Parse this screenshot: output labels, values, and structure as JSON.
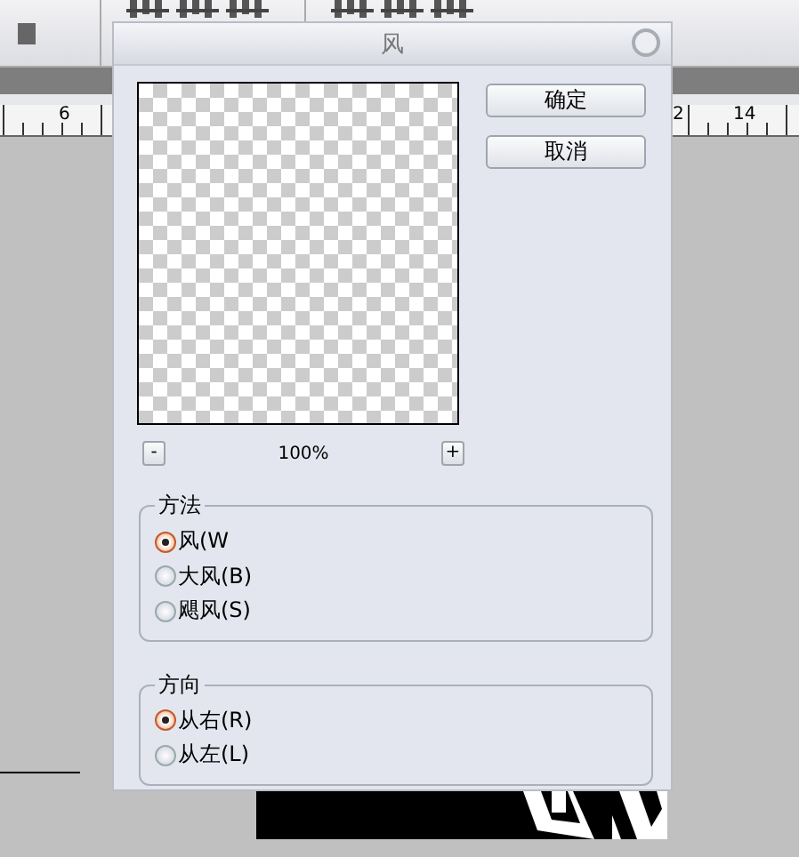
{
  "ruler": {
    "labels": [
      "6",
      "2",
      "14"
    ]
  },
  "dialog": {
    "title": "风",
    "buttons": [
      "确定",
      "取消"
    ],
    "zoom": {
      "minus": "-",
      "value": "100%",
      "plus": "+"
    },
    "groups": [
      {
        "title": "方法",
        "options": [
          {
            "label": "风(W",
            "selected": true
          },
          {
            "label": "大风(B)",
            "selected": false
          },
          {
            "label": "飓风(S)",
            "selected": false
          }
        ]
      },
      {
        "title": "方向",
        "options": [
          {
            "label": "从右(R)",
            "selected": true
          },
          {
            "label": "从左(L)",
            "selected": false
          }
        ]
      }
    ]
  }
}
